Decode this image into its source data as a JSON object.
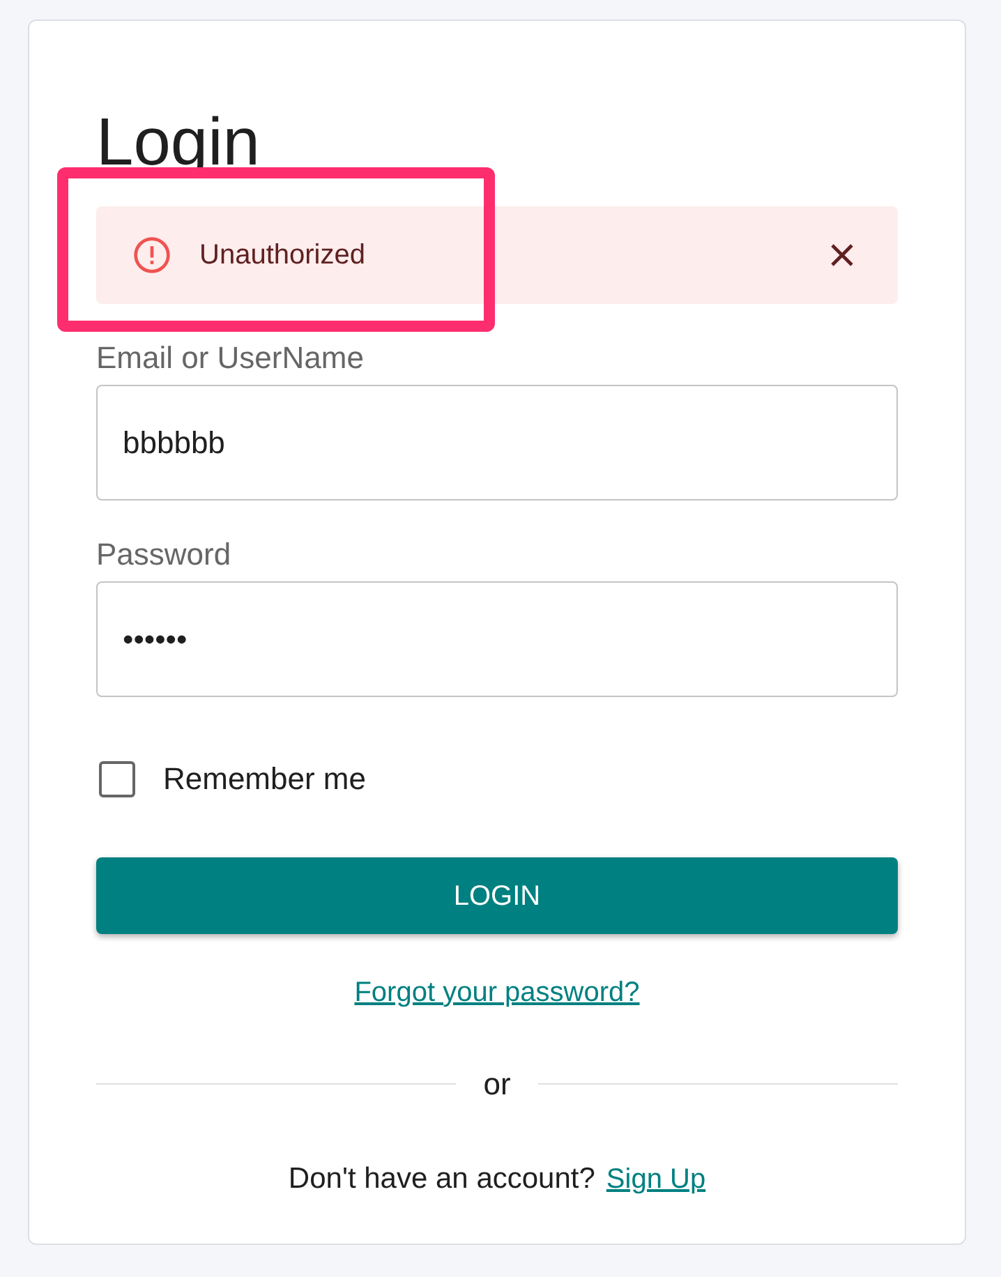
{
  "title": "Login",
  "alert": {
    "message": "Unauthorized",
    "highlighted": true
  },
  "fields": [
    {
      "label": "Email or UserName",
      "value": "bbbbbb"
    },
    {
      "label": "Password",
      "value": "••••••"
    }
  ],
  "remember": {
    "label": "Remember me",
    "checked": false
  },
  "login_button": "LOGIN",
  "forgot_link": "Forgot your password?",
  "divider_text": "or",
  "signup": {
    "prompt": "Don't have an account?",
    "link": "Sign Up"
  }
}
